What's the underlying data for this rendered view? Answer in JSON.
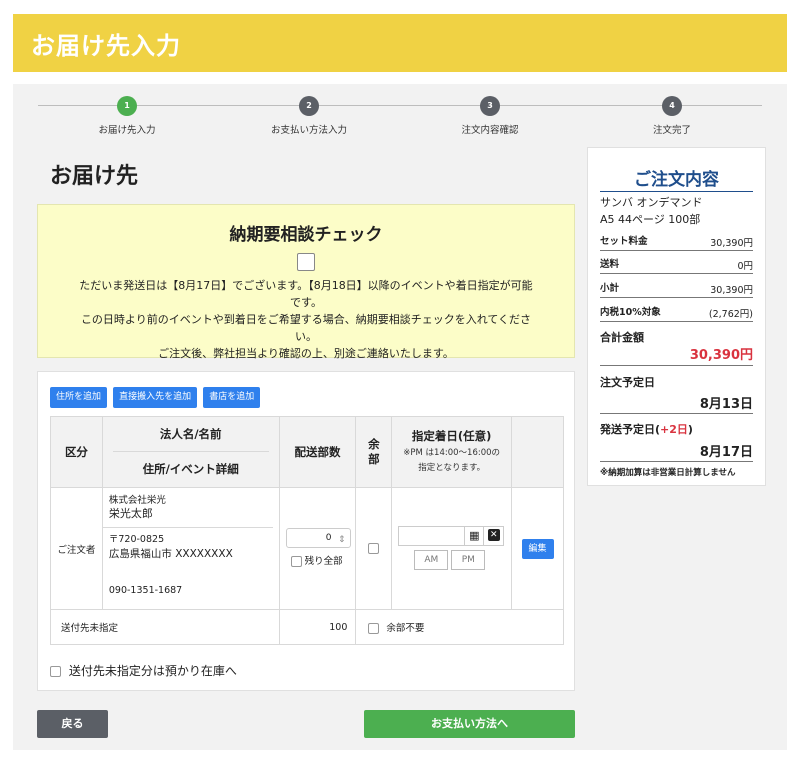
{
  "header": {
    "title": "お届け先入力"
  },
  "steps": [
    {
      "num": "1",
      "label": "お届け先入力"
    },
    {
      "num": "2",
      "label": "お支払い方法入力"
    },
    {
      "num": "3",
      "label": "注文内容確認"
    },
    {
      "num": "4",
      "label": "注文完了"
    }
  ],
  "section_title": "お届け先",
  "notice": {
    "title": "納期要相談チェック",
    "line1": "ただいま発送日は【8月17日】でございます。【8月18日】以降のイベントや着日指定が可能です。",
    "line2": "この日時より前のイベントや到着日をご希望する場合、納期要相談チェックを入れてください。",
    "line3": "ご注文後、弊社担当より確認の上、別途ご連絡いたします。"
  },
  "buttons": {
    "add_address": "住所を追加",
    "add_direct": "直接搬入先を追加",
    "add_store": "書店を追加",
    "edit": "編集",
    "back": "戻る",
    "next": "お支払い方法へ"
  },
  "table": {
    "h_category": "区分",
    "h_name": "法人名/名前",
    "h_address": "住所/イベント詳細",
    "h_qty": "配送部数",
    "h_surplus": "余部",
    "h_date": "指定着日(任意)",
    "h_date_note1": "※PM は14:00〜16:00の",
    "h_date_note2": "指定となります。",
    "row1": {
      "category": "ご注文者",
      "company": "株式会社栄光",
      "name": "栄光太郎",
      "zip": "〒720-0825",
      "address": "広島県福山市 XXXXXXXX",
      "phone": "090-1351-1687",
      "qty": "0",
      "remaining_label": "残り全部",
      "am": "AM",
      "pm": "PM"
    },
    "row2": {
      "category": "送付先未指定",
      "qty": "100",
      "surplus_label": "余部不要"
    }
  },
  "stock_label": "送付先未指定分は預かり在庫へ",
  "summary": {
    "title": "ご注文内容",
    "product": "サンバ オンデマンド",
    "spec": "A5  44ページ  100部",
    "set_price_label": "セット料金",
    "set_price": "30,390円",
    "shipping_label": "送料",
    "shipping": "0円",
    "subtotal_label": "小計",
    "subtotal": "30,390円",
    "tax_label": "内税10%対象",
    "tax": "(2,762円)",
    "total_label": "合計金額",
    "total": "30,390円",
    "order_date_label": "注文予定日",
    "order_date": "8月13日",
    "ship_date_label": "発送予定日",
    "ship_add": "+2日",
    "ship_date": "8月17日",
    "note": "※納期加算は非営業日計算しません"
  },
  "colors": {
    "header": "#f0d244",
    "primary": "#2f80ed",
    "success": "#4caf50",
    "total": "#d9333f",
    "summary_title": "#1f4e8c"
  }
}
